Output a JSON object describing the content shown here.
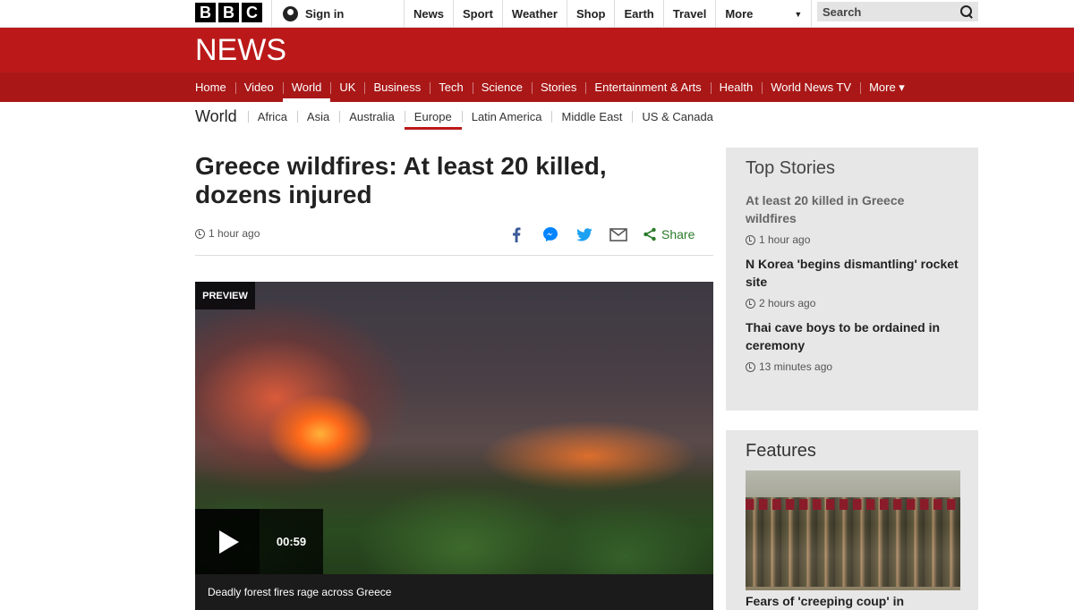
{
  "topbar": {
    "logo_letters": [
      "B",
      "B",
      "C"
    ],
    "signin_label": "Sign in",
    "links": [
      "News",
      "Sport",
      "Weather",
      "Shop",
      "Earth",
      "Travel"
    ],
    "more_label": "More",
    "search_placeholder": "Search"
  },
  "header": {
    "title": "NEWS"
  },
  "nav": {
    "items": [
      {
        "label": "Home"
      },
      {
        "label": "Video"
      },
      {
        "label": "World"
      },
      {
        "label": "UK"
      },
      {
        "label": "Business"
      },
      {
        "label": "Tech"
      },
      {
        "label": "Science"
      },
      {
        "label": "Stories"
      },
      {
        "label": "Entertainment & Arts"
      },
      {
        "label": "Health"
      },
      {
        "label": "World News TV"
      },
      {
        "label": "More ▾"
      }
    ],
    "active_index": 2
  },
  "subnav": {
    "section": "World",
    "items": [
      "Africa",
      "Asia",
      "Australia",
      "Europe",
      "Latin America",
      "Middle East",
      "US & Canada"
    ],
    "active_index": 3
  },
  "article": {
    "headline": "Greece wildfires: At least 20 killed, dozens injured",
    "timestamp": "1 hour ago",
    "share_label": "Share",
    "share_icons": [
      "facebook-icon",
      "messenger-icon",
      "twitter-icon",
      "email-icon",
      "share-icon"
    ],
    "video": {
      "badge": "PREVIEW",
      "duration": "00:59",
      "caption": "Deadly forest fires rage across Greece"
    }
  },
  "top_stories": {
    "heading": "Top Stories",
    "items": [
      {
        "title": "At least 20 killed in Greece wildfires",
        "time": "1 hour ago"
      },
      {
        "title": "N Korea 'begins dismantling' rocket site",
        "time": "2 hours ago"
      },
      {
        "title": "Thai cave boys to be ordained in ceremony",
        "time": "13 minutes ago"
      }
    ]
  },
  "features": {
    "heading": "Features",
    "first_title": "Fears of 'creeping coup' in"
  },
  "colors": {
    "brand_red": "#bb1919",
    "nav_red": "#a91717",
    "share_green": "#2a7a2a",
    "facebook_blue": "#3b5998",
    "messenger_blue": "#0084ff",
    "twitter_blue": "#1da1f2"
  }
}
